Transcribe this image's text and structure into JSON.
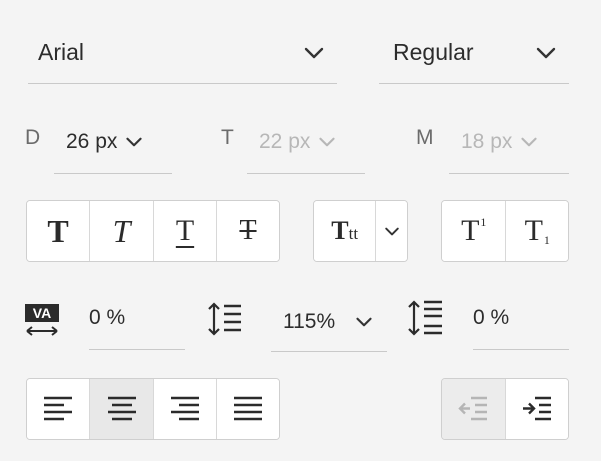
{
  "font": {
    "family": "Arial",
    "style": "Regular"
  },
  "sizes": {
    "desktop": {
      "label": "D",
      "value": "26 px"
    },
    "tablet": {
      "label": "T",
      "value": "22 px"
    },
    "mobile": {
      "label": "M",
      "value": "18 px"
    }
  },
  "style_buttons": [
    "bold-icon",
    "italic-icon",
    "underline-icon",
    "strikethrough-icon"
  ],
  "case_button": {
    "glyph": "T",
    "small": "tt"
  },
  "position_buttons": {
    "superscript": {
      "glyph": "T",
      "mark": "1"
    },
    "subscript": {
      "glyph": "T",
      "mark": "1"
    }
  },
  "spacing": {
    "character_spacing": "0 %",
    "line_height": "115%",
    "paragraph_spacing": "0 %"
  },
  "alignment": {
    "options": [
      "align-left",
      "align-center",
      "align-right",
      "justify"
    ],
    "selected": "align-center"
  },
  "indent": {
    "decrease_enabled": false,
    "increase_enabled": true
  },
  "colors": {
    "panel_bg": "#f4f4f4",
    "text": "#2c2c2c",
    "border": "#cfcfcf",
    "selected_bg": "#e8e8e8",
    "disabled_text": "#b7b7b7"
  }
}
